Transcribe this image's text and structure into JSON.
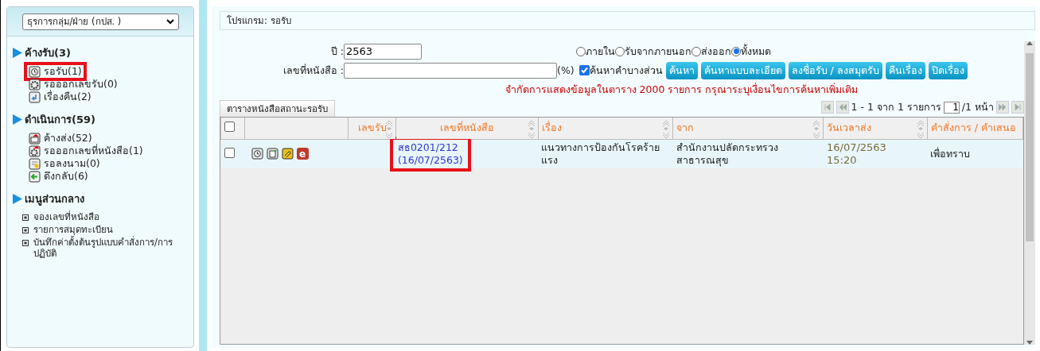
{
  "sidebar": {
    "dropdown": "ธุรการกลุ่ม/ฝ่าย (กปส. )",
    "sections": [
      {
        "title": "ค้างรับ(3)",
        "kind": "icons",
        "items": [
          {
            "label": "รอรับ(1)",
            "highlighted": true
          },
          {
            "label": "รอออกเลขรับ(0)",
            "highlighted": false
          },
          {
            "label": "เรื่องคืน(2)",
            "highlighted": false
          }
        ]
      },
      {
        "title": "ดำเนินการ(59)",
        "kind": "icons",
        "items": [
          {
            "label": "ค้างส่ง(52)",
            "highlighted": false
          },
          {
            "label": "รอออกเลขที่หนังสือ(1)",
            "highlighted": false
          },
          {
            "label": "รอลงนาม(0)",
            "highlighted": false
          },
          {
            "label": "ดึงกลับ(6)",
            "highlighted": false
          }
        ]
      },
      {
        "title": "เมนูส่วนกลาง",
        "kind": "bullets",
        "items": [
          {
            "label": "จองเลขที่หนังสือ"
          },
          {
            "label": "รายการสมุดทะเบียน"
          },
          {
            "label": "บันทึกค่าตั้งต้นรูปแบบคำสั่งการ/การปฏิบัติ"
          }
        ]
      }
    ]
  },
  "page_title": "โปรแกรม: รอรับ",
  "form": {
    "year_label": "ปี :",
    "year_value": "2563",
    "docno_label": "เลขที่หนังสือ :",
    "docno_suffix": "(%)",
    "partial": {
      "label": "ค้นหาคำบางส่วน",
      "checked": true
    },
    "scopes": [
      {
        "label": "ภายใน",
        "selected": false
      },
      {
        "label": "รับจากภายนอก",
        "selected": false
      },
      {
        "label": "ส่งออก",
        "selected": false
      },
      {
        "label": "ทั้งหมด",
        "selected": true
      }
    ],
    "buttons": [
      "ค้นหา",
      "ค้นหาแบบละเอียด",
      "ลงชื่อรับ / ลงสมุดรับ",
      "คืนเรื่อง",
      "ปิดเรื่อง"
    ],
    "warning": "จำกัดการแสดงข้อมูลในตาราง 2000 รายการ กรุณาระบุเงื่อนไขการค้นหาเพิ่มเติม"
  },
  "tab": "ตารางหนังสือสถานะรอรับ",
  "pager": {
    "summary": "1 - 1 จาก 1 รายการ",
    "page": "1",
    "total": "/1 หน้า"
  },
  "table": {
    "header_checked": false,
    "columns": [
      {
        "kind": "check"
      },
      {
        "kind": "icons"
      },
      {
        "kind": "text",
        "label": "เลขรับ",
        "sortable": true
      },
      {
        "kind": "text",
        "label": "เลขที่หนังสือ",
        "sortable": true
      },
      {
        "kind": "text",
        "label": "เรื่อง",
        "sortable": true
      },
      {
        "kind": "text",
        "label": "จาก",
        "sortable": true
      },
      {
        "kind": "text",
        "label": "วันเวลาส่ง",
        "sortable": true
      },
      {
        "kind": "text",
        "label": "คำสั่งการ / คำเสนอ",
        "sortable": false
      }
    ],
    "rows": [
      {
        "checked": false,
        "badge": "e",
        "doc_no": "สธ0201/212",
        "doc_date": "(16/07/2563)",
        "doc_highlighted": true,
        "subject": "แนวทางการป้องกันโรคร้ายแรง",
        "from": "สำนักงานปลัดกระทรวงสาธารณสุข",
        "sent_date": "16/07/2563",
        "sent_time": "15:20",
        "order": "เพื่อทราบ"
      }
    ]
  }
}
